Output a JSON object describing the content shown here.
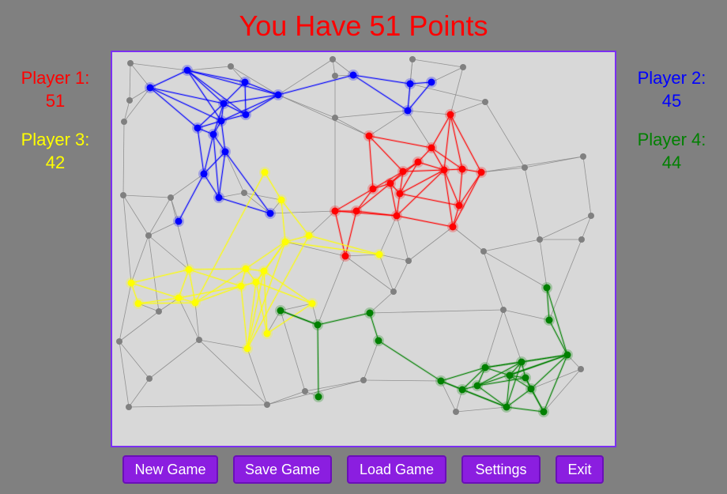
{
  "title": "You Have 51 Points",
  "players": [
    {
      "label": "Player 1:",
      "score": "51",
      "color": "#ff0000"
    },
    {
      "label": "Player 2:",
      "score": "45",
      "color": "#0000ff"
    },
    {
      "label": "Player 3:",
      "score": "42",
      "color": "#ffff00"
    },
    {
      "label": "Player 4:",
      "score": "44",
      "color": "#008000"
    }
  ],
  "buttons": {
    "new_game": "New Game",
    "save_game": "Save Game",
    "load_game": "Load Game",
    "settings": "Settings",
    "exit": "Exit"
  },
  "colors": {
    "board_background": "#d8d8d8",
    "board_border": "#7b2ff2",
    "neutral_node": "#808080",
    "button": "#8b1ee0",
    "page_background": "#808080"
  }
}
